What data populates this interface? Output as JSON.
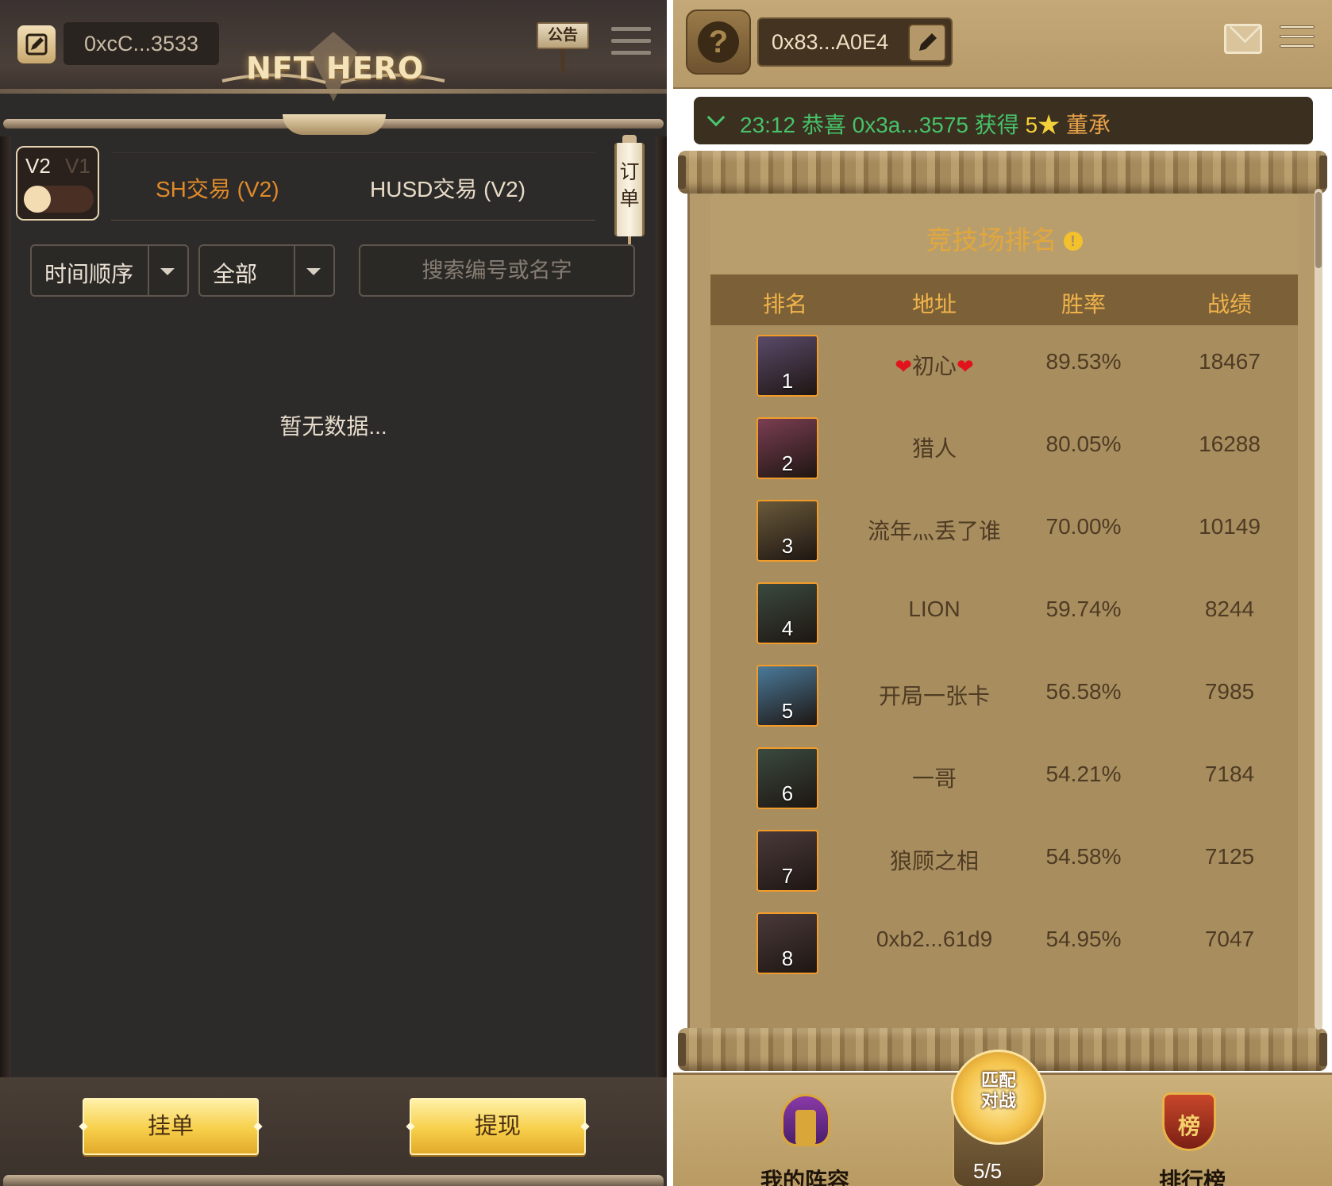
{
  "left": {
    "wallet_address": "0xcC...3533",
    "logo_text": "NFT HERO",
    "notice_label": "公告",
    "version_toggle": {
      "active": "V2",
      "inactive": "V1"
    },
    "tabs": [
      {
        "label": "SH交易 (V2)",
        "active": true
      },
      {
        "label": "HUSD交易 (V2)",
        "active": false
      }
    ],
    "order_scroll_label": "订单",
    "sort_select": {
      "value": "时间顺序"
    },
    "filter_select": {
      "value": "全部"
    },
    "search": {
      "placeholder": "搜索编号或名字",
      "value": ""
    },
    "empty_text": "暂无数据...",
    "footer_buttons": [
      "挂单",
      "提现"
    ]
  },
  "right": {
    "wallet_address": "0x83...A0E4",
    "ticker": {
      "time": "23:12",
      "prefix": "恭喜",
      "address": "0x3a...3575",
      "verb": "获得",
      "stars": "5★",
      "hero": "董承"
    },
    "leaderboard": {
      "title": "竞技场排名",
      "columns": [
        "排名",
        "地址",
        "胜率",
        "战绩"
      ],
      "rows": [
        {
          "rank": "1",
          "name": "初心",
          "rate": "89.53%",
          "score": "18467",
          "hearts": true,
          "avatar_color": "#5a4a6a"
        },
        {
          "rank": "2",
          "name": "猎人",
          "rate": "80.05%",
          "score": "16288",
          "hearts": false,
          "avatar_color": "#7a3e52"
        },
        {
          "rank": "3",
          "name": "流年灬丢了谁",
          "rate": "70.00%",
          "score": "10149",
          "hearts": false,
          "avatar_color": "#6a5a3a"
        },
        {
          "rank": "4",
          "name": "LION",
          "rate": "59.74%",
          "score": "8244",
          "hearts": false,
          "avatar_color": "#3a4a3e"
        },
        {
          "rank": "5",
          "name": "开局一张卡",
          "rate": "56.58%",
          "score": "7985",
          "hearts": false,
          "avatar_color": "#4a7a9a"
        },
        {
          "rank": "6",
          "name": "一哥",
          "rate": "54.21%",
          "score": "7184",
          "hearts": false,
          "avatar_color": "#3a4a3e"
        },
        {
          "rank": "7",
          "name": "狼顾之相",
          "rate": "54.58%",
          "score": "7125",
          "hearts": false,
          "avatar_color": "#4a3a3a"
        },
        {
          "rank": "8",
          "name": "0xb2...61d9",
          "rate": "54.95%",
          "score": "7047",
          "hearts": false,
          "avatar_color": "#4a3a3a"
        }
      ]
    },
    "footer": {
      "match_label_1": "匹配",
      "match_label_2": "对战",
      "match_count": "5/5",
      "nav_labels": [
        "我的阵容",
        "排行榜"
      ],
      "rank_icon_char": "榜"
    }
  }
}
